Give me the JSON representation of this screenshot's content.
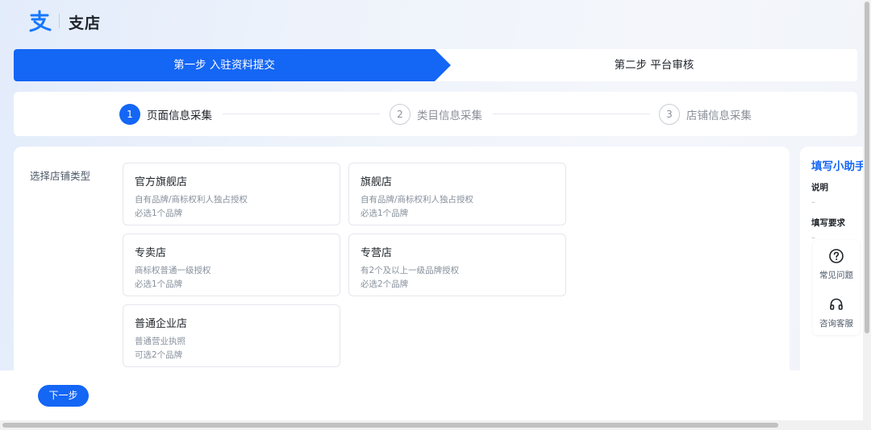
{
  "header": {
    "logo_text": "支店",
    "logo_icon": "alipay-logo-icon"
  },
  "steps": [
    {
      "label": "第一步 入驻资料提交",
      "active": true
    },
    {
      "label": "第二步 平台审核",
      "active": false
    }
  ],
  "substeps": [
    {
      "num": "1",
      "label": "页面信息采集",
      "active": true
    },
    {
      "num": "2",
      "label": "类目信息采集",
      "active": false
    },
    {
      "num": "3",
      "label": "店铺信息采集",
      "active": false
    }
  ],
  "form": {
    "label": "选择店铺类型",
    "options": [
      {
        "title": "官方旗舰店",
        "desc1": "自有品牌/商标权利人独占授权",
        "desc2": "必选1个品牌"
      },
      {
        "title": "旗舰店",
        "desc1": "自有品牌/商标权利人独占授权",
        "desc2": "必选1个品牌"
      },
      {
        "title": "专卖店",
        "desc1": "商标权普通一级授权",
        "desc2": "必选1个品牌"
      },
      {
        "title": "专营店",
        "desc1": "有2个及以上一级品牌授权",
        "desc2": "必选2个品牌"
      },
      {
        "title": "普通企业店",
        "desc1": "普通营业执照",
        "desc2": "可选2个品牌"
      }
    ]
  },
  "helper": {
    "title": "填写小助手",
    "section1": "说明",
    "section1_value": "–",
    "section2": "填写要求",
    "section2_value": "–"
  },
  "float_menu": [
    {
      "icon": "question-circle-icon",
      "label": "常见问题"
    },
    {
      "icon": "headset-icon",
      "label": "咨询客服"
    }
  ],
  "footer": {
    "next_label": "下一步"
  },
  "colors": {
    "primary": "#1466f5",
    "text": "#1f2329",
    "muted": "#86909c"
  }
}
